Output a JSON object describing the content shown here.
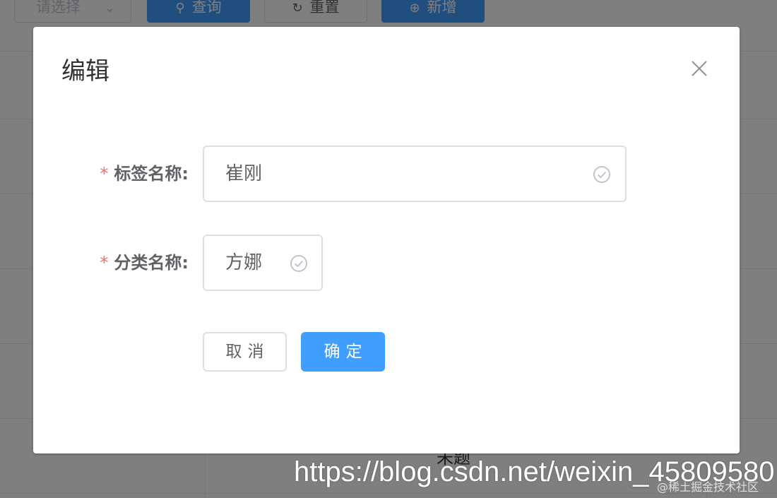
{
  "background": {
    "select_placeholder": "请选择",
    "buttons": [
      {
        "label": "查询",
        "icon": "search-icon"
      },
      {
        "label": "重置",
        "icon": "refresh-icon"
      },
      {
        "label": "新增",
        "icon": "plus-circle-icon"
      }
    ],
    "partial_cell_text": "未题"
  },
  "dialog": {
    "title": "编辑",
    "close_icon": "close-icon",
    "fields": [
      {
        "required_mark": "*",
        "label": "标签名称:",
        "value": "崔刚",
        "status_icon": "check-circle-icon"
      },
      {
        "required_mark": "*",
        "label": "分类名称:",
        "value": "方娜",
        "status_icon": "check-circle-icon"
      }
    ],
    "buttons": {
      "cancel": "取消",
      "confirm": "确定"
    }
  },
  "watermark": {
    "url": "https://blog.csdn.net/weixin_45809580",
    "sub": "@稀土掘金技术社区"
  },
  "colors": {
    "primary": "#409eff",
    "required": "#f56c6c",
    "border": "#dcdfe6",
    "text": "#606266",
    "mask": "rgba(0,0,0,0.5)"
  }
}
